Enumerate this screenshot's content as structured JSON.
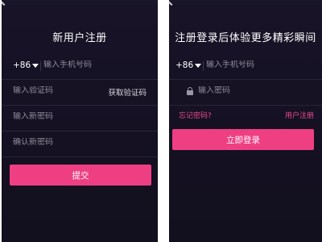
{
  "register": {
    "title": "新用户注册",
    "country_code": "+86",
    "phone_placeholder": "输入手机号码",
    "code_placeholder": "输入验证码",
    "get_code_label": "获取验证码",
    "new_password_placeholder": "输入新密码",
    "confirm_password_placeholder": "确认新密码",
    "submit_label": "提交"
  },
  "login": {
    "title": "注册登录后体验更多精彩瞬间",
    "country_code": "+86",
    "phone_placeholder": "输入手机号码",
    "password_placeholder": "输入密码",
    "forgot_password_label": "忘记密码?",
    "register_link_label": "用户注册",
    "login_button_label": "立即登录"
  },
  "colors": {
    "background": "#161224",
    "accent": "#ef3f83",
    "link": "#ea4a8b",
    "placeholder": "#8e8a99"
  },
  "icons": [
    "caret-down-icon",
    "lock-icon",
    "back-chevron-icon"
  ]
}
